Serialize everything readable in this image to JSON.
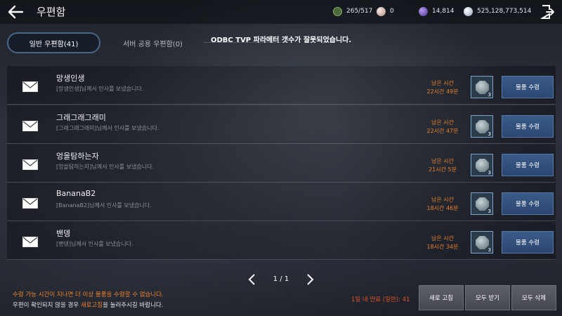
{
  "header": {
    "title": "우편함",
    "back_icon": "arrow-left-icon",
    "exit_icon": "exit-door-icon"
  },
  "resources": {
    "weight": "265/517",
    "pearl": "0",
    "energy": "14,814",
    "silver": "525,128,773,514"
  },
  "tabs": {
    "general": "일반 우편함(41)",
    "server": "서버 공용 우편함(0)"
  },
  "toast": "ODBC TVP 파라메터 갯수가 잘못되었습니다.",
  "mails": [
    {
      "sender": "망생인생",
      "message": "[망생인생]님께서 인사를 보냈습니다.",
      "remain_label": "남은 시간",
      "remain": "22시간 49분",
      "item_count": "3",
      "button": "물품 수령"
    },
    {
      "sender": "그래그래그래미",
      "message": "[그래그래그래미]님께서 인사를 보냈습니다.",
      "remain_label": "남은 시간",
      "remain": "22시간 47분",
      "item_count": "3",
      "button": "물품 수령"
    },
    {
      "sender": "엉을탐하는자",
      "message": "[엉을탐하는자]님께서 인사를 보냈습니다.",
      "remain_label": "남은 시간",
      "remain": "21시간 5분",
      "item_count": "3",
      "button": "물품 수령"
    },
    {
      "sender": "BananaB2",
      "message": "[BananaB2]님께서 인사를 보냈습니다.",
      "remain_label": "남은 시간",
      "remain": "18시간 46분",
      "item_count": "3",
      "button": "물품 수령"
    },
    {
      "sender": "밴뎅",
      "message": "[밴뎅]님께서 인사를 보냈습니다.",
      "remain_label": "남은 시간",
      "remain": "18시간 34분",
      "item_count": "3",
      "button": "물품 수령"
    }
  ],
  "pager": {
    "text": "1 / 1"
  },
  "notice": {
    "line1": "수령 가능 시간이 지나면 더 이상 물품을 수령할 수 없습니다.",
    "line2_a": "우편이 확인되지 않을 경우 ",
    "line2_highlight": "새로고침",
    "line2_b": "을 눌러주시길 바랍니다."
  },
  "expire_text": "1일 내 만료 (일반): 41",
  "buttons": {
    "refresh": "새로 고침",
    "receive_all": "모두 받기",
    "delete_all": "모두 삭제"
  }
}
